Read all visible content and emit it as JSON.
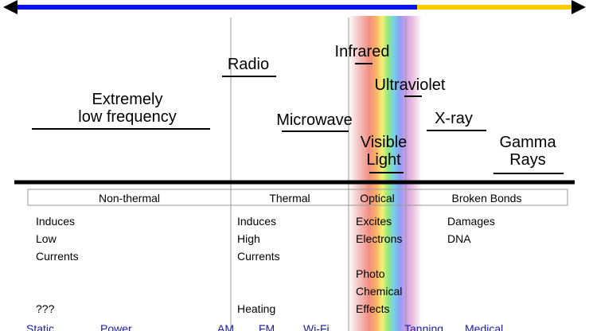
{
  "bands": {
    "elf_line1": "Extremely",
    "elf_line2": "low frequency",
    "radio": "Radio",
    "microwave": "Microwave",
    "infrared": "Infrared",
    "ultraviolet": "Ultraviolet",
    "visible_line1": "Visible",
    "visible_line2": "Light",
    "xray": "X-ray",
    "gamma_line1": "Gamma",
    "gamma_line2": "Rays"
  },
  "categories": {
    "nonthermal": "Non-thermal",
    "thermal": "Thermal",
    "optical": "Optical",
    "broken": "Broken Bonds"
  },
  "effects": {
    "nonthermal": [
      "Induces",
      "Low",
      "Currents",
      "",
      "",
      "???"
    ],
    "thermal": [
      "Induces",
      "High",
      "Currents",
      "",
      "",
      "Heating"
    ],
    "optical": [
      "Excites",
      "Electrons",
      "",
      "Photo",
      "Chemical",
      "Effects"
    ],
    "broken": [
      "Damages",
      "DNA"
    ]
  },
  "applications": [
    "Static",
    "Power",
    "AM",
    "FM",
    "Wi-Fi",
    "Tanning",
    "Medical"
  ],
  "colors": {
    "arrow_low": "#0a14e6",
    "arrow_high": "#ffcc00",
    "divider": "#000000"
  }
}
